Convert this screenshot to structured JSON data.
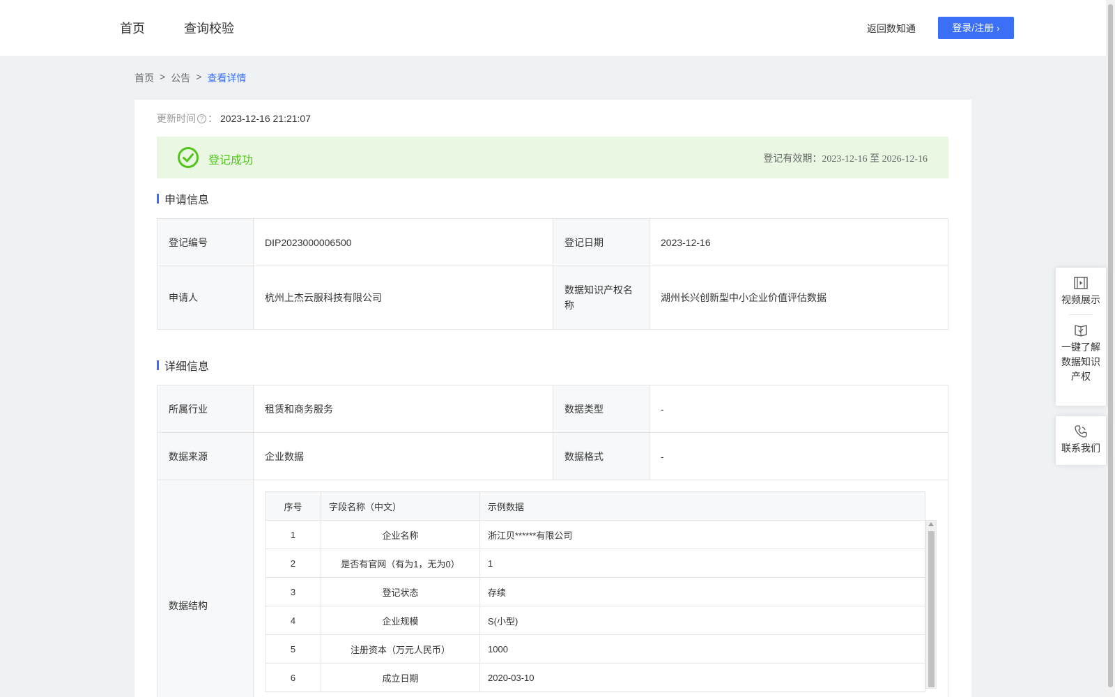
{
  "header": {
    "nav": [
      "首页",
      "查询校验"
    ],
    "back_link": "返回数知通",
    "login_button": "登录/注册"
  },
  "breadcrumb": {
    "items": [
      "首页",
      "公告",
      "查看详情"
    ],
    "separator": ">"
  },
  "update": {
    "label": "更新时间",
    "colon": "：",
    "value": "2023-12-16 21:21:07"
  },
  "status": {
    "text": "登记成功",
    "validity_label": "登记有效期：",
    "validity_value": "2023-12-16 至 2026-12-16",
    "color": "#52c41a"
  },
  "application": {
    "title": "申请信息",
    "rows": [
      {
        "l1": "登记编号",
        "v1": "DIP2023000006500",
        "l2": "登记日期",
        "v2": "2023-12-16"
      },
      {
        "l1": "申请人",
        "v1": "杭州上杰云服科技有限公司",
        "l2": "数据知识产权名称",
        "v2": "湖州长兴创新型中小企业价值评估数据"
      }
    ]
  },
  "details": {
    "title": "详细信息",
    "rows": [
      {
        "l1": "所属行业",
        "v1": "租赁和商务服务",
        "l2": "数据类型",
        "v2": "-"
      },
      {
        "l1": "数据来源",
        "v1": "企业数据",
        "l2": "数据格式",
        "v2": "-"
      }
    ],
    "structure_label": "数据结构",
    "structure": {
      "headers": [
        "序号",
        "字段名称（中文）",
        "示例数据"
      ],
      "rows": [
        [
          "1",
          "企业名称",
          "浙江贝******有限公司"
        ],
        [
          "2",
          "是否有官网（有为1，无为0）",
          "1"
        ],
        [
          "3",
          "登记状态",
          "存续"
        ],
        [
          "4",
          "企业规模",
          "S(小型)"
        ],
        [
          "5",
          "注册资本（万元人民币）",
          "1000"
        ],
        [
          "6",
          "成立日期",
          "2020-03-10"
        ]
      ]
    }
  },
  "side_panel": {
    "video": "视频展示",
    "learn": [
      "一键了解",
      "数据知识",
      "产权"
    ],
    "contact": "联系我们"
  },
  "colors": {
    "accent": "#3b6ff5",
    "success_bg": "#e9f7e3",
    "page_bg": "#eff2f5"
  }
}
